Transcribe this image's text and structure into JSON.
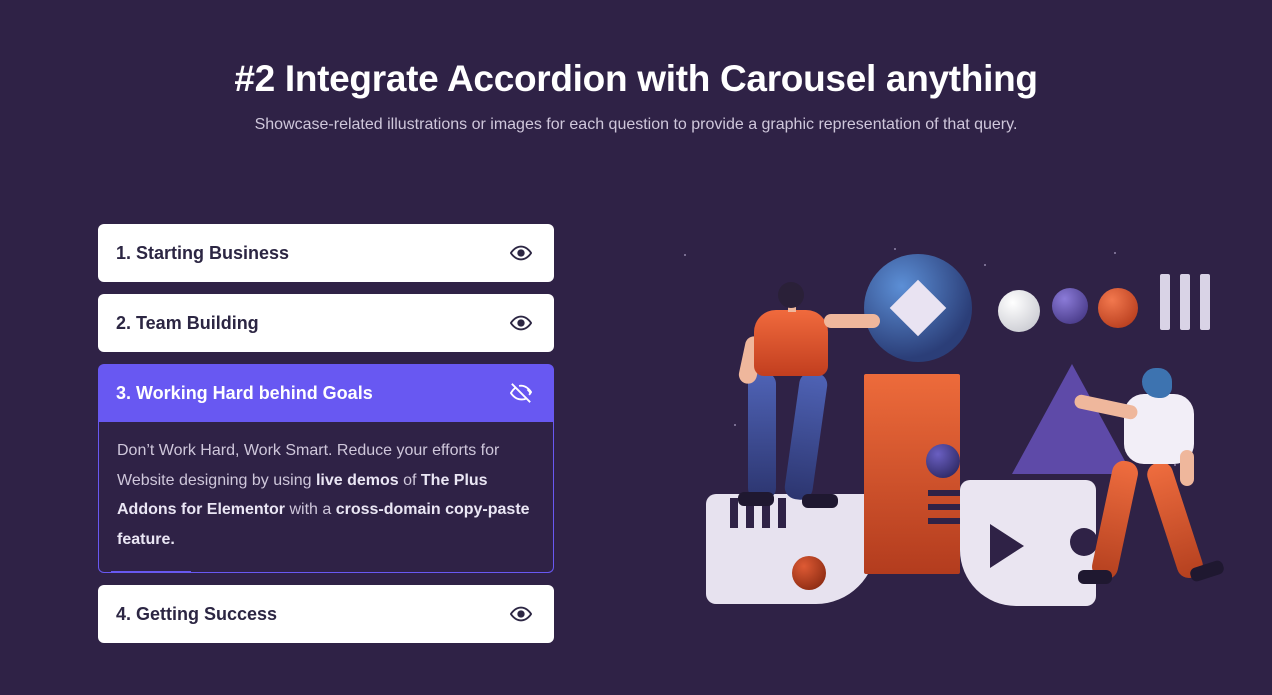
{
  "header": {
    "title": "#2 Integrate Accordion with Carousel anything",
    "subtitle": "Showcase-related illustrations or images for each question to provide a graphic representation of that query."
  },
  "accordion": {
    "items": [
      {
        "label": "1. Starting Business",
        "active": false
      },
      {
        "label": "2. Team Building",
        "active": false
      },
      {
        "label": "3. Working Hard behind Goals",
        "active": true,
        "body_pre": "Don’t Work Hard, Work Smart. Reduce your efforts for Website designing by using ",
        "body_strong1": "live demos",
        "body_mid1": " of ",
        "body_strong2": "The Plus Addons for Elementor",
        "body_mid2": " with a ",
        "body_strong3": "cross-domain copy-paste feature."
      },
      {
        "label": "4. Getting Success",
        "active": false
      }
    ]
  },
  "icons": {
    "eye": "eye-icon",
    "eye_off": "eye-off-icon"
  }
}
